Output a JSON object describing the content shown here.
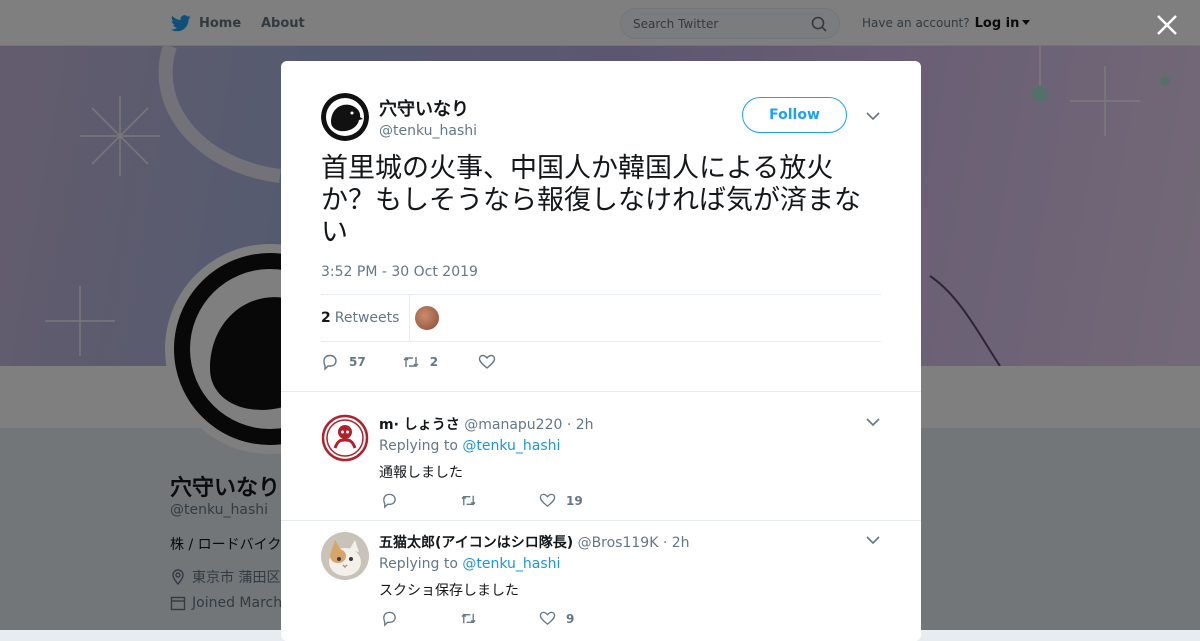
{
  "nav": {
    "home_label": "Home",
    "about_label": "About",
    "search_placeholder": "Search Twitter",
    "account_prompt": "Have an account?",
    "login_label": "Log in"
  },
  "profile": {
    "name": "穴守いなり",
    "handle": "@tenku_hashi",
    "bio": "株 / ロードバイク",
    "location": "東京市 蒲田区",
    "joined": "Joined March"
  },
  "tweet": {
    "author_name": "穴守いなり",
    "author_handle": "@tenku_hashi",
    "follow_label": "Follow",
    "text": "首里城の火事、中国人か韓国人による放火か？もしそうなら報復しなければ気が済まない",
    "timestamp": "3:52 PM - 30 Oct 2019",
    "retweet_count": "2",
    "retweets_label": "Retweets",
    "reply_count": "57",
    "action_retweet_count": "2",
    "like_count": ""
  },
  "replies": [
    {
      "name": "m· しょうさ",
      "handle": "@manapu220",
      "time": "· 2h",
      "replying_prefix": "Replying to",
      "replying_to": "@tenku_hashi",
      "text": "通報しました",
      "reply_count": "",
      "retweet_count": "",
      "like_count": "19"
    },
    {
      "name": "五猫太郎(アイコンはシロ隊長)",
      "handle": "@Bros119K",
      "time": "· 2h",
      "replying_prefix": "Replying to",
      "replying_to": "@tenku_hashi",
      "text": "スクショ保存しました",
      "reply_count": "",
      "retweet_count": "",
      "like_count": "9"
    }
  ],
  "colors": {
    "twitter_blue": "#1da1f2",
    "link_blue": "#1b95e0",
    "text_dark": "#14171a",
    "text_gray": "#657786",
    "overlay": "rgba(0,0,0,0.5)"
  },
  "icons": {
    "logo": "twitter-bird-icon",
    "search": "search-icon",
    "close": "close-icon",
    "reply": "reply-icon",
    "retweet": "retweet-icon",
    "like": "heart-icon",
    "caret": "chevron-down-icon"
  }
}
